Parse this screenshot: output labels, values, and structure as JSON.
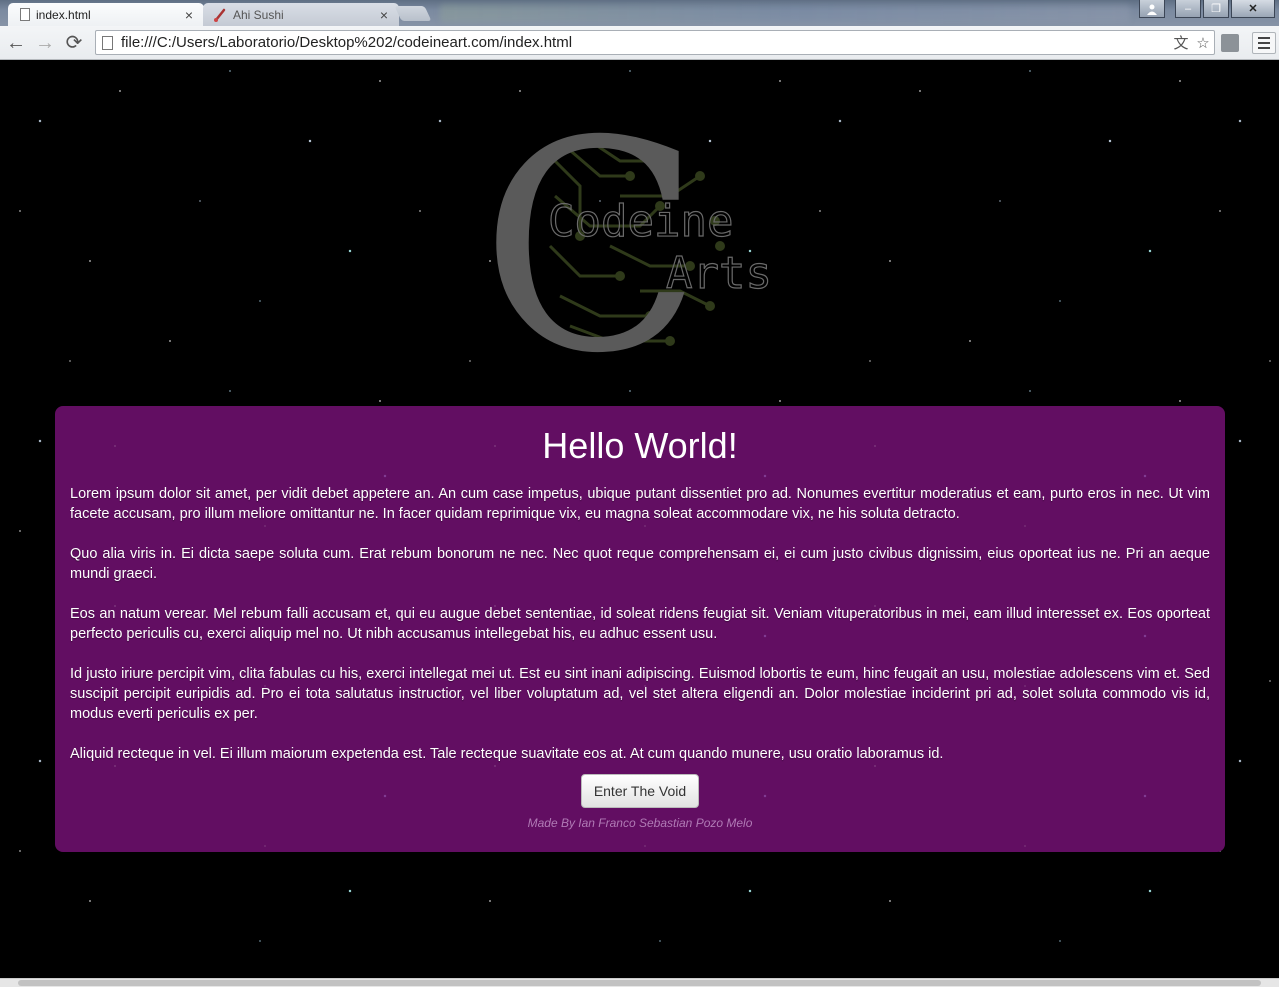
{
  "browser": {
    "tabs": [
      {
        "label": "index.html",
        "active": true,
        "icon": "page-icon"
      },
      {
        "label": "Ahi Sushi",
        "active": false,
        "icon": "brush-favicon"
      }
    ],
    "close_glyph": "×",
    "url": "file:///C:/Users/Laboratorio/Desktop%202/codeineart.com/index.html",
    "nav": {
      "back": "←",
      "forward": "→",
      "reload": "⟳"
    },
    "omnibox_icons": {
      "translate": "文",
      "bookmark": "☆"
    },
    "window_controls": {
      "user": "👤",
      "minimize": "–",
      "maximize": "❐",
      "close": "✕"
    }
  },
  "logo": {
    "letter": "C",
    "line1": "Codeine",
    "line2": "Arts"
  },
  "content": {
    "heading": "Hello World!",
    "paragraphs": [
      "Lorem ipsum dolor sit amet, per vidit debet appetere an. An cum case impetus, ubique putant dissentiet pro ad. Nonumes evertitur moderatius et eam, purto eros in nec. Ut vim facete accusam, pro illum meliore omittantur ne. In facer quidam reprimique vix, eu magna soleat accommodare vix, ne his soluta detracto.",
      "Quo alia viris in. Ei dicta saepe soluta cum. Erat rebum bonorum ne nec. Nec quot reque comprehensam ei, ei cum justo civibus dignissim, eius oporteat ius ne. Pri an aeque mundi graeci.",
      "Eos an natum verear. Mel rebum falli accusam et, qui eu augue debet sententiae, id soleat ridens feugiat sit. Veniam vituperatoribus in mei, eam illud interesset ex. Eos oporteat perfecto periculis cu, exerci aliquip mel no. Ut nibh accusamus intellegebat his, eu adhuc essent usu.",
      "Id justo iriure percipit vim, clita fabulas cu his, exerci intellegat mei ut. Est eu sint inani adipiscing. Euismod lobortis te eum, hinc feugait an usu, molestiae adolescens vim et. Sed suscipit percipit euripidis ad. Pro ei tota salutatus instructior, vel liber voluptatum ad, vel stet altera eligendi an. Dolor molestiae inciderint pri ad, solet soluta commodo vis id, modus everti periculis ex per.",
      "Aliquid recteque in vel. Ei illum maiorum expetenda est. Tale recteque suavitate eos at. At cum quando munere, usu oratio laboramus id."
    ],
    "button_label": "Enter The Void",
    "credit": "Made By Ian Franco Sebastian Pozo Melo"
  },
  "colors": {
    "panel_bg": "#620e62",
    "page_bg": "#000000",
    "logo_gray": "#5a5a5a",
    "circuit": "#2f3a1a",
    "credit_text": "#b07ab5"
  }
}
